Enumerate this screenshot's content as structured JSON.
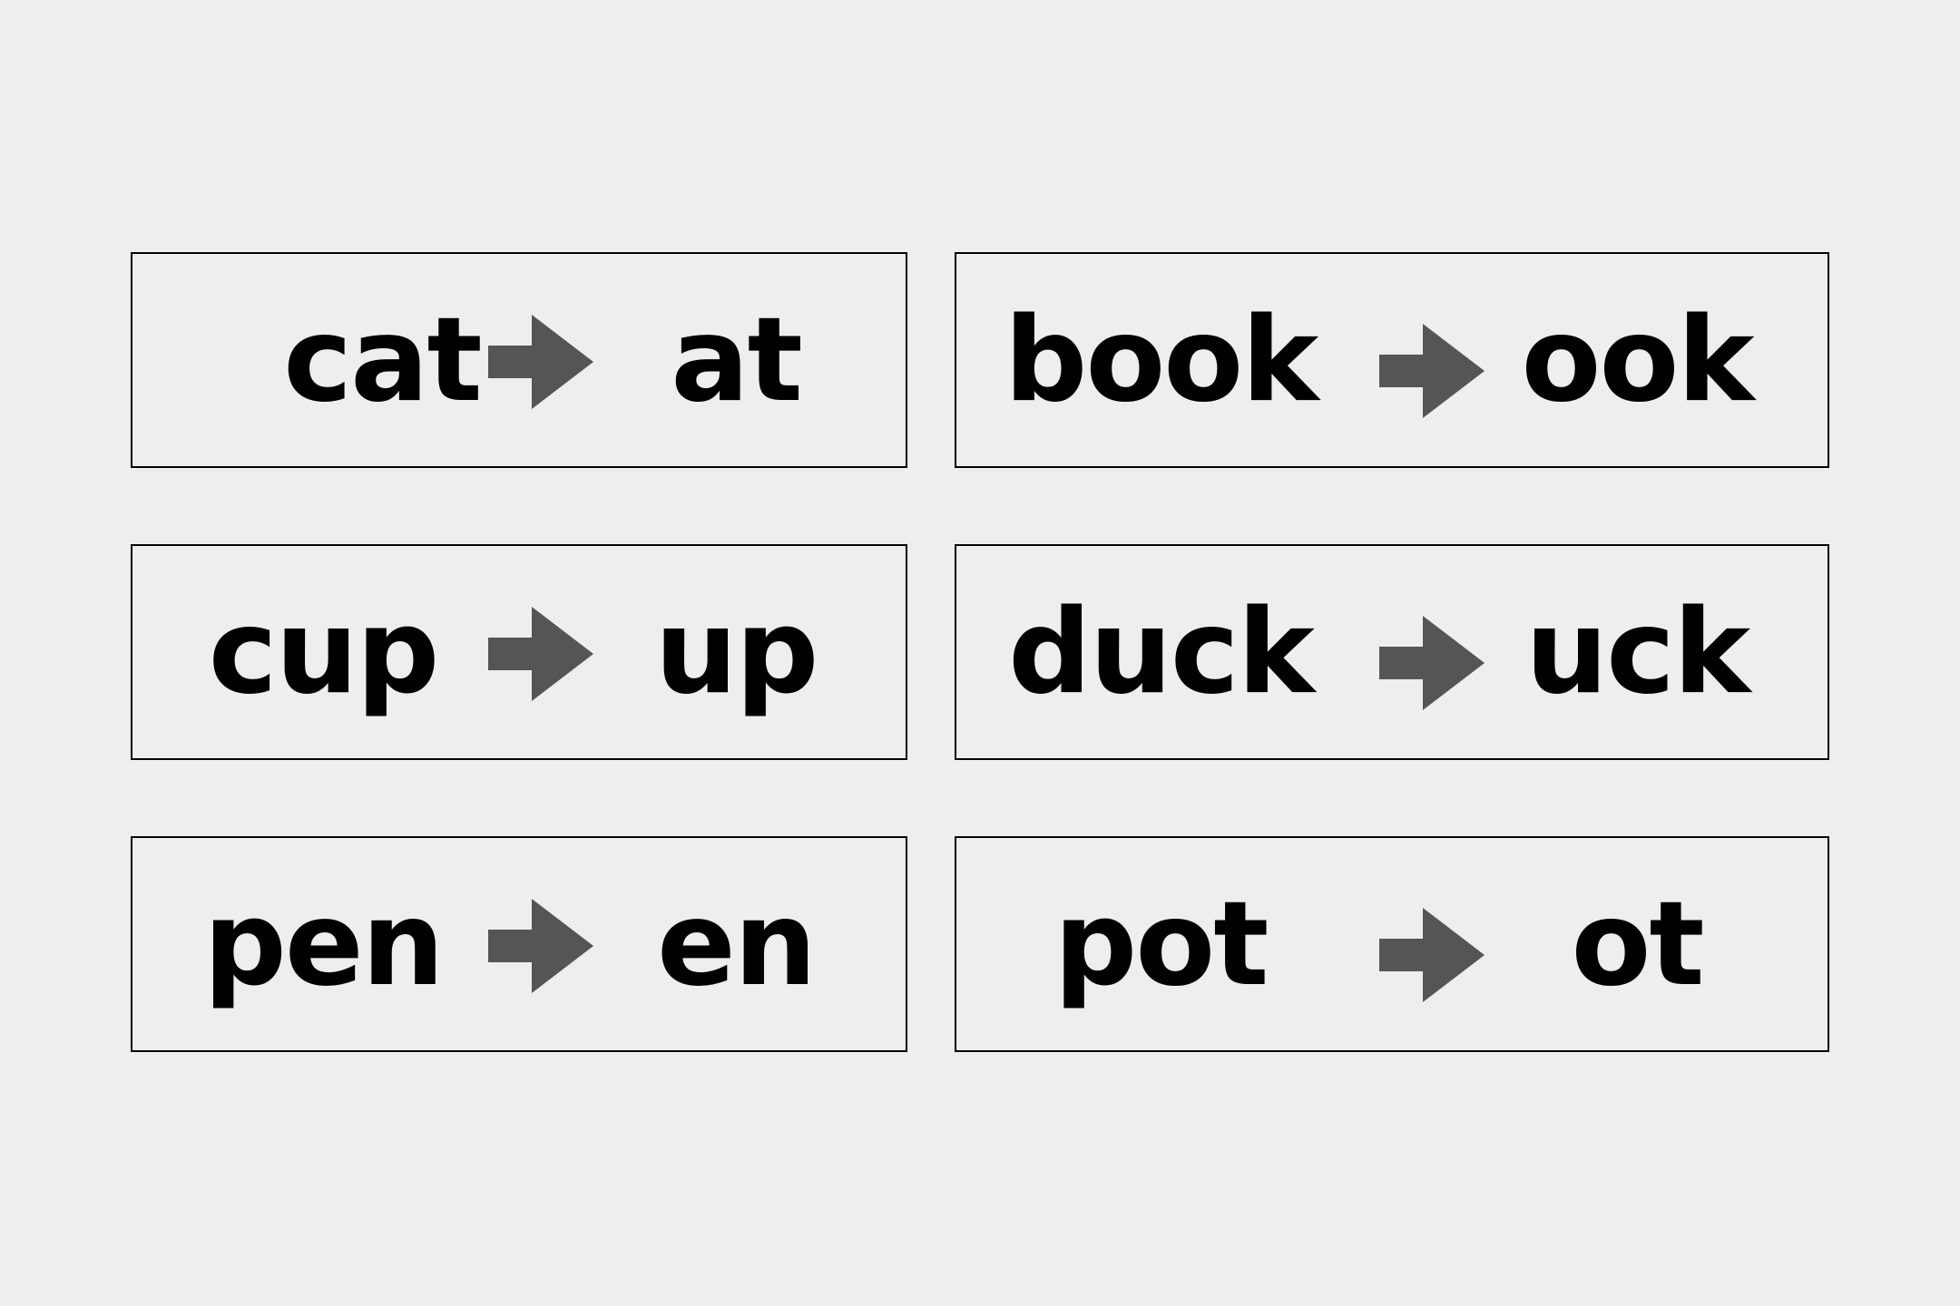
{
  "colors": {
    "background": "#eeeeee",
    "card_border": "#000000",
    "text": "#000000",
    "arrow": "#555555"
  },
  "cards": [
    {
      "word": "cat",
      "result": "at",
      "arrow_icon": "right-arrow-icon"
    },
    {
      "word": "book",
      "result": "ook",
      "arrow_icon": "right-arrow-icon"
    },
    {
      "word": "cup",
      "result": "up",
      "arrow_icon": "right-arrow-icon"
    },
    {
      "word": "duck",
      "result": "uck",
      "arrow_icon": "right-arrow-icon"
    },
    {
      "word": "pen",
      "result": "en",
      "arrow_icon": "right-arrow-icon"
    },
    {
      "word": "pot",
      "result": "ot",
      "arrow_icon": "right-arrow-icon"
    }
  ]
}
